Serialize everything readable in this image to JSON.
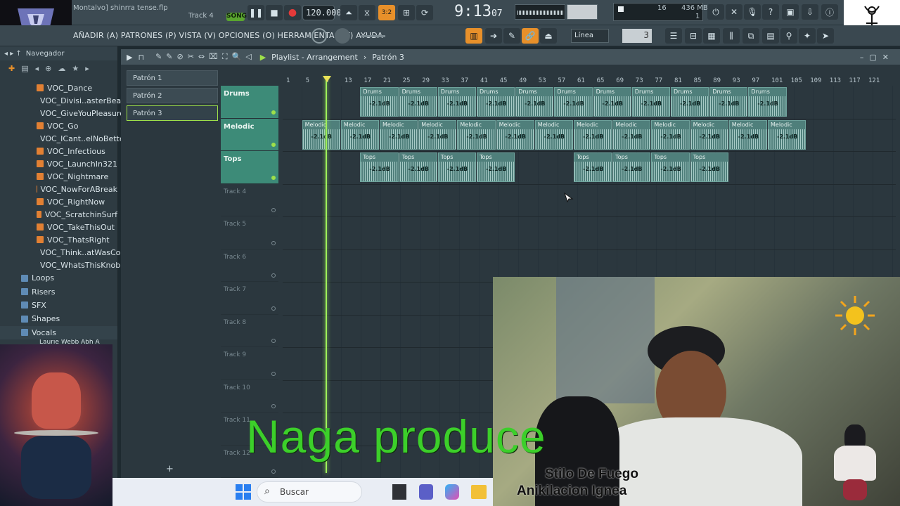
{
  "window": {
    "title": "Montalvo] shinrra tense.flp",
    "track_label": "Track 4",
    "song_label": "SONG",
    "bpm": "120.000",
    "time": "9:13",
    "time_sub": "07",
    "pattern_counter": "3:2",
    "mem_value1": "16",
    "mem_value2": "436 MB",
    "mem_value3": "1"
  },
  "menu": {
    "items": "AÑADIR (A) PATRONES (P) VISTA (V) OPCIONES (O) HERRAMIENTAS (T) AYUDA",
    "snap_label": "Línea",
    "snap_value": "3"
  },
  "browser": {
    "title": "Navegador",
    "files": [
      "VOC_Dance",
      "VOC_Divisi..asterBeat",
      "VOC_GiveYouPleasure",
      "VOC_Go",
      "VOC_ICant..elNoBetter",
      "VOC_Infectious",
      "VOC_LaunchIn321",
      "VOC_Nightmare",
      "VOC_NowForABreak",
      "VOC_RightNow",
      "VOC_ScratchinSurf",
      "VOC_TakeThisOut",
      "VOC_ThatsRight",
      "VOC_Think..atWasCool",
      "VOC_WhatsThisKnob"
    ],
    "folders": [
      "Loops",
      "Risers",
      "SFX",
      "Shapes",
      "Vocals"
    ],
    "partial_item": "Laurie Webb Abh A"
  },
  "playlist": {
    "title": "Playlist - Arrangement",
    "breadcrumb": "Patrón 3",
    "patterns": [
      "Patrón 1",
      "Patrón 2",
      "Patrón 3"
    ],
    "tracks": [
      "Drums",
      "Melodic",
      "Tops",
      "Track 4",
      "Track 5",
      "Track 6",
      "Track 7",
      "Track 8",
      "Track 9",
      "Track 10",
      "Track 11",
      "Track 12"
    ],
    "ruler": [
      "1",
      "5",
      "9",
      "13",
      "17",
      "21",
      "25",
      "29",
      "33",
      "37",
      "41",
      "45",
      "49",
      "53",
      "57",
      "61",
      "65",
      "69",
      "73",
      "77",
      "81",
      "85",
      "89",
      "93",
      "97",
      "101",
      "105",
      "109",
      "113",
      "117",
      "121"
    ],
    "clip_gain": "-2.1dB",
    "clip_names": {
      "drums": "Drums",
      "melodic": "Melodic",
      "tops": "Tops"
    }
  },
  "taskbar": {
    "search_placeholder": "Buscar"
  },
  "overlay": {
    "title": "Naga produce",
    "line1": "Stilo De Fuego",
    "line2": "Anikilacion Ignea"
  },
  "colors": {
    "accent_green": "#9ee04a",
    "clip_teal": "#4f7f7b",
    "overlay_green": "#3ccf2a",
    "orange_button": "#e8902a"
  }
}
